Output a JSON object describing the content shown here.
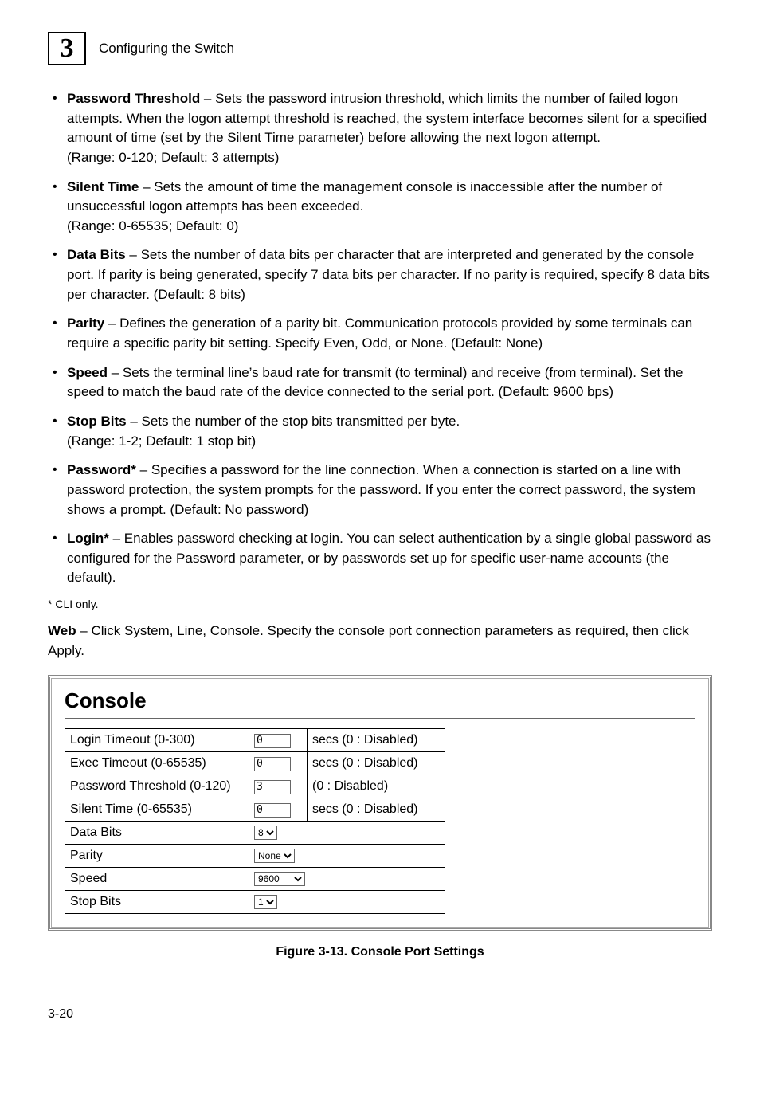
{
  "header": {
    "chapter_number": "3",
    "title": "Configuring the Switch"
  },
  "bullets": [
    {
      "term": "Password Threshold",
      "desc": " – Sets the password intrusion threshold, which limits the number of failed logon attempts. When the logon attempt threshold is reached, the system interface becomes silent for a specified amount of time (set by the Silent Time parameter) before allowing the next logon attempt.\n(Range: 0-120; Default: 3 attempts)"
    },
    {
      "term": "Silent Time",
      "desc": " – Sets the amount of time the management console is inaccessible after the number of unsuccessful logon attempts has been exceeded.\n(Range: 0-65535; Default: 0)"
    },
    {
      "term": "Data Bits",
      "desc": " – Sets the number of data bits per character that are interpreted and generated by the console port. If parity is being generated, specify 7 data bits per character. If no parity is required, specify 8 data bits per character. (Default: 8 bits)"
    },
    {
      "term": "Parity",
      "desc": " – Defines the generation of a parity bit. Communication protocols provided by some terminals can require a specific parity bit setting. Specify Even, Odd, or None. (Default: None)"
    },
    {
      "term": "Speed",
      "desc": " – Sets the terminal line’s baud rate for transmit (to terminal) and receive (from terminal). Set the speed to match the baud rate of the device connected to the serial port. (Default: 9600 bps)"
    },
    {
      "term": "Stop Bits",
      "desc": " – Sets the number of the stop bits transmitted per byte.\n(Range: 1-2; Default: 1 stop bit)"
    },
    {
      "term": "Password*",
      "desc": " – Specifies a password for the line connection. When a connection is started on a line with password protection, the system prompts for the password. If you enter the correct password, the system shows a prompt. (Default: No password)"
    },
    {
      "term": "Login*",
      "desc": " – Enables password checking at login. You can select authentication by a single global password as configured for the Password parameter, or by passwords set up for specific user-name accounts (the default)."
    }
  ],
  "footnote": "* CLI only.",
  "web_para_bold": "Web",
  "web_para_rest": " – Click System, Line, Console. Specify the console port connection parameters as required, then click Apply.",
  "panel": {
    "title": "Console",
    "rows": {
      "login_timeout": {
        "label": "Login Timeout (0-300)",
        "value": "0",
        "suffix": "secs (0 : Disabled)"
      },
      "exec_timeout": {
        "label": "Exec Timeout (0-65535)",
        "value": "0",
        "suffix": "secs (0 : Disabled)"
      },
      "password_threshold": {
        "label": "Password Threshold (0-120)",
        "value": "3",
        "suffix": "(0 : Disabled)"
      },
      "silent_time": {
        "label": "Silent Time (0-65535)",
        "value": "0",
        "suffix": "secs (0 : Disabled)"
      },
      "data_bits": {
        "label": "Data Bits",
        "value": "8"
      },
      "parity": {
        "label": "Parity",
        "value": "None"
      },
      "speed": {
        "label": "Speed",
        "value": "9600"
      },
      "stop_bits": {
        "label": "Stop Bits",
        "value": "1"
      }
    }
  },
  "figure_caption": "Figure 3-13.  Console Port Settings",
  "page_number": "3-20"
}
